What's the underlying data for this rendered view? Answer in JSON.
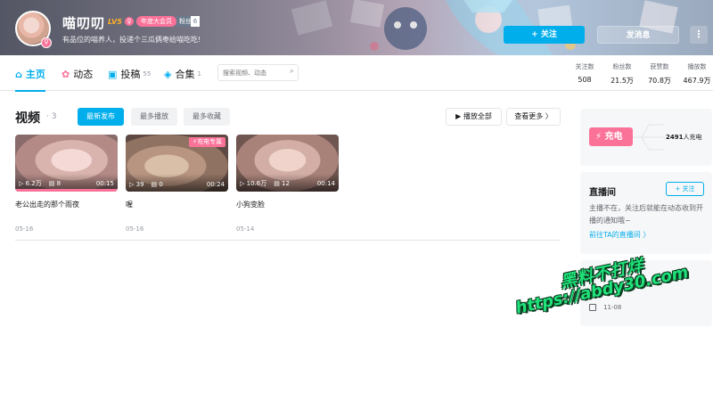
{
  "profile": {
    "username": "喵叨叨",
    "level": "LV5",
    "sex_icon": "♀",
    "vip_badge": "年度大会员",
    "fan_medal": "粉丝",
    "fan_medal_level": "6",
    "signature": "有品位的喵养人，投递个三瓜俩枣给喵吃吃!",
    "follow_label": "+ 关注",
    "message_label": "发消息",
    "more_label": "⋮"
  },
  "nav": {
    "home": "主页",
    "dynamic": "动态",
    "submissions": "投稿",
    "submissions_count": "55",
    "collections": "合集",
    "collections_count": "1",
    "search_placeholder": "搜索视频、动态"
  },
  "stats": [
    {
      "label": "关注数",
      "value": "508"
    },
    {
      "label": "粉丝数",
      "value": "21.5万"
    },
    {
      "label": "获赞数",
      "value": "70.8万"
    },
    {
      "label": "播放数",
      "value": "467.9万"
    }
  ],
  "videos_section": {
    "title": "视频",
    "count": "· 3",
    "tab_newest": "最新发布",
    "tab_most_played": "最多播放",
    "tab_most_fav": "最多收藏",
    "play_all": "▶ 播放全部",
    "see_more": "查看更多 〉"
  },
  "videos": [
    {
      "title": "老公出走的那个雨夜",
      "plays": "6.2万",
      "danmaku": "8",
      "duration": "00:15",
      "date": "05-16",
      "tag": ""
    },
    {
      "title": "喔",
      "plays": "39",
      "danmaku": "0",
      "duration": "00:24",
      "date": "05-16",
      "tag": "⚡充电专属"
    },
    {
      "title": "小狗变脸",
      "plays": "10.6万",
      "danmaku": "12",
      "duration": "00:14",
      "date": "05-14",
      "tag": ""
    }
  ],
  "charge": {
    "button": "⚡ 充电",
    "count_num": "2491",
    "count_suffix": "人充电"
  },
  "live": {
    "title": "直播间",
    "follow": "+ 关注",
    "desc": "主播不在，关注后就能在动态收到开播的通知哦~",
    "link": "前往TA的直播间 〉"
  },
  "info": {
    "date": "11-08"
  },
  "watermark": {
    "line1": "黑料不打烊",
    "line2": "https://abdy30.com"
  },
  "colors": {
    "accent": "#00aeec",
    "pink": "#fb7299",
    "watermark_green": "#1fe27a"
  }
}
